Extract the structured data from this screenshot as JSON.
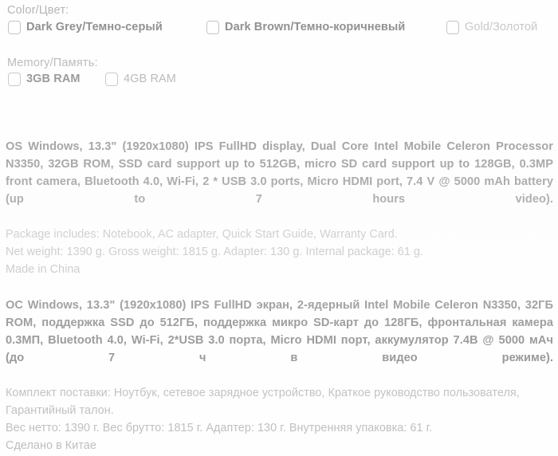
{
  "options": {
    "color": {
      "label": "Color/Цвет:",
      "items": [
        {
          "label": "Dark Grey/Темно-серый",
          "checked": false
        },
        {
          "label": "Dark Brown/Темно-коричневый",
          "checked": false
        },
        {
          "label": "Gold/Золотой",
          "checked": false
        }
      ]
    },
    "memory": {
      "label": "Memory/Память:",
      "items": [
        {
          "label": "3GB RAM",
          "checked": false
        },
        {
          "label": "4GB RAM",
          "checked": false
        }
      ]
    }
  },
  "spec_en": {
    "main": "OS Windows, 13.3\" (1920x1080) IPS FullHD display, Dual Core Intel Mobile Celeron Processor N3350, 32GB ROM, SSD card support up to 512GB, micro SD card support up to 128GB, 0.3MP front camera, Bluetooth 4.0, Wi-Fi, 2 * USB 3.0 ports, Micro HDMI port, 7.4 V @ 5000 mAh battery (up to 7 hours video).",
    "package": "Package includes:  Notebook, AC adapter, Quick Start Guide, Warranty Card.",
    "weight": "Net weight: 1390 g. Gross weight: 1815 g. Adapter: 130 g. Internal package: 61 g.",
    "origin": "Made in China"
  },
  "spec_ru": {
    "main": "ОС Windows, 13.3\" (1920x1080) IPS FullHD экран, 2-ядерный Intel Mobile Celeron N3350, 32ГБ ROM, поддержка SSD до 512ГБ, поддержка микро SD-карт до 128ГБ, фронтальная камера 0.3МП, Bluetooth 4.0, Wi-Fi, 2*USB 3.0 порта, Micro HDMI порт, аккумулятор 7.4В @ 5000 мАч (до 7 ч в видео режиме).",
    "package": "Комплект поставки: Ноутбук, сетевое зарядное устройство, Краткое руководство пользователя, Гарантийный талон.",
    "weight": "Вес нетто: 1390 г. Вес брутто: 1815 г. Адаптер: 130 г. Внутренняя упаковка: 61 г.",
    "origin": "Сделано в Китае"
  }
}
